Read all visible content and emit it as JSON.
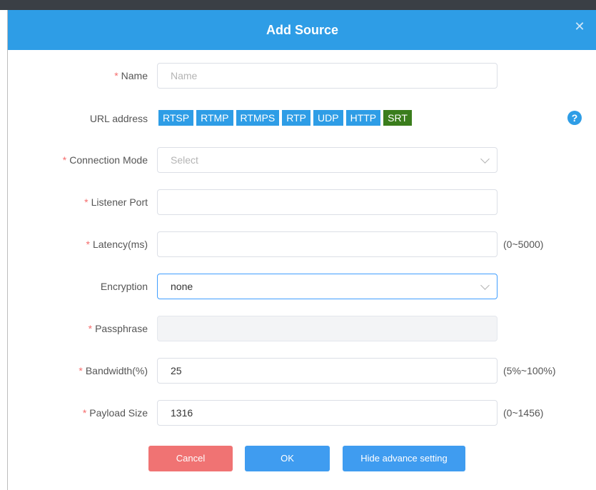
{
  "dialog": {
    "title": "Add Source",
    "close_icon": "close-icon"
  },
  "form": {
    "name": {
      "label": "Name",
      "required": true,
      "placeholder": "Name",
      "value": ""
    },
    "url_address": {
      "label": "URL address",
      "protocols": [
        "RTSP",
        "RTMP",
        "RTMPS",
        "RTP",
        "UDP",
        "HTTP",
        "SRT"
      ],
      "selected": "SRT",
      "help_icon": "help-icon",
      "help_glyph": "?"
    },
    "connection_mode": {
      "label": "Connection Mode",
      "required": true,
      "placeholder": "Select",
      "value": ""
    },
    "listener_port": {
      "label": "Listener Port",
      "required": true,
      "value": ""
    },
    "latency": {
      "label": "Latency(ms)",
      "required": true,
      "value": "",
      "hint": "(0~5000)"
    },
    "encryption": {
      "label": "Encryption",
      "required": false,
      "value": "none"
    },
    "passphrase": {
      "label": "Passphrase",
      "required": true,
      "value": "",
      "disabled": true
    },
    "bandwidth": {
      "label": "Bandwidth(%)",
      "required": true,
      "value": "25",
      "hint": "(5%~100%)"
    },
    "payload_size": {
      "label": "Payload Size",
      "required": true,
      "value": "1316",
      "hint": "(0~1456)"
    }
  },
  "buttons": {
    "cancel": "Cancel",
    "ok": "OK",
    "advance": "Hide advance setting"
  },
  "colors": {
    "header": "#2e9de6",
    "protocol": "#2e9de6",
    "protocol_active": "#3a7d1c",
    "cancel": "#f07373",
    "primary": "#3f9cf0",
    "required": "#f56c6c"
  }
}
